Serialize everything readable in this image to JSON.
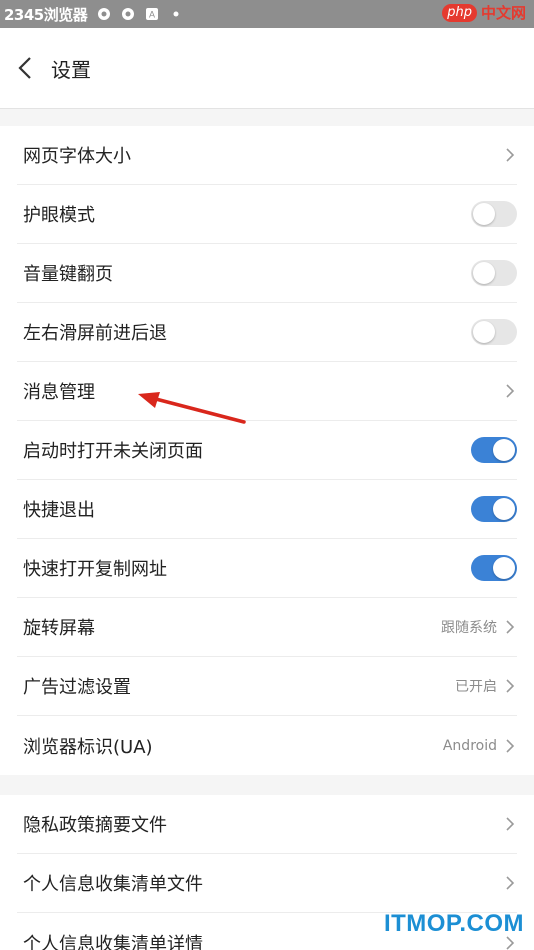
{
  "status_bar": {
    "app_title": "2345浏览器",
    "watermark_php": "php",
    "watermark_cn": "中文网"
  },
  "header": {
    "title": "设置"
  },
  "settings_group1": [
    {
      "label": "网页字体大小",
      "type": "chevron"
    },
    {
      "label": "护眼模式",
      "type": "toggle",
      "on": false
    },
    {
      "label": "音量键翻页",
      "type": "toggle",
      "on": false
    },
    {
      "label": "左右滑屏前进后退",
      "type": "toggle",
      "on": false
    },
    {
      "label": "消息管理",
      "type": "chevron"
    },
    {
      "label": "启动时打开未关闭页面",
      "type": "toggle",
      "on": true
    },
    {
      "label": "快捷退出",
      "type": "toggle",
      "on": true
    },
    {
      "label": "快速打开复制网址",
      "type": "toggle",
      "on": true
    },
    {
      "label": "旋转屏幕",
      "type": "chevron",
      "value": "跟随系统"
    },
    {
      "label": "广告过滤设置",
      "type": "chevron",
      "value": "已开启"
    },
    {
      "label": "浏览器标识(UA)",
      "type": "chevron",
      "value": "Android"
    }
  ],
  "settings_group2": [
    {
      "label": "隐私政策摘要文件",
      "type": "chevron"
    },
    {
      "label": "个人信息收集清单文件",
      "type": "chevron"
    },
    {
      "label": "个人信息收集清单详情",
      "type": "chevron"
    }
  ],
  "watermark_footer": "ITMOP.COM",
  "colors": {
    "toggle_on": "#3b82d6",
    "toggle_off": "#e6e6e6",
    "arrow": "#d9271c"
  }
}
